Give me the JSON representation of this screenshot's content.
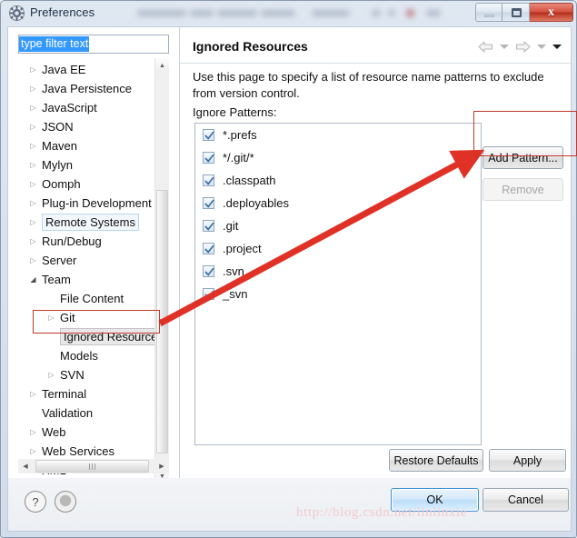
{
  "window": {
    "title": "Preferences",
    "icon": "gear-icon",
    "controls": {
      "minimize": "minimize",
      "maximize": "restore",
      "close": "x"
    }
  },
  "sidebar": {
    "filter": {
      "value": "type filter text",
      "placeholder": "type filter text"
    },
    "items": [
      {
        "label": "Java EE",
        "depth": 0,
        "twisty": "collapsed",
        "state": "normal"
      },
      {
        "label": "Java Persistence",
        "depth": 0,
        "twisty": "collapsed",
        "state": "normal"
      },
      {
        "label": "JavaScript",
        "depth": 0,
        "twisty": "collapsed",
        "state": "normal"
      },
      {
        "label": "JSON",
        "depth": 0,
        "twisty": "collapsed",
        "state": "normal"
      },
      {
        "label": "Maven",
        "depth": 0,
        "twisty": "collapsed",
        "state": "normal"
      },
      {
        "label": "Mylyn",
        "depth": 0,
        "twisty": "collapsed",
        "state": "normal"
      },
      {
        "label": "Oomph",
        "depth": 0,
        "twisty": "collapsed",
        "state": "normal"
      },
      {
        "label": "Plug-in Development",
        "depth": 0,
        "twisty": "collapsed",
        "state": "normal"
      },
      {
        "label": "Remote Systems",
        "depth": 0,
        "twisty": "collapsed",
        "state": "focused"
      },
      {
        "label": "Run/Debug",
        "depth": 0,
        "twisty": "collapsed",
        "state": "normal"
      },
      {
        "label": "Server",
        "depth": 0,
        "twisty": "collapsed",
        "state": "normal"
      },
      {
        "label": "Team",
        "depth": 0,
        "twisty": "expanded",
        "state": "normal"
      },
      {
        "label": "File Content",
        "depth": 1,
        "twisty": "none",
        "state": "normal"
      },
      {
        "label": "Git",
        "depth": 1,
        "twisty": "collapsed",
        "state": "normal"
      },
      {
        "label": "Ignored Resource",
        "depth": 1,
        "twisty": "none",
        "state": "selected"
      },
      {
        "label": "Models",
        "depth": 1,
        "twisty": "none",
        "state": "normal"
      },
      {
        "label": "SVN",
        "depth": 1,
        "twisty": "collapsed",
        "state": "normal"
      },
      {
        "label": "Terminal",
        "depth": 0,
        "twisty": "collapsed",
        "state": "normal"
      },
      {
        "label": "Validation",
        "depth": 0,
        "twisty": "none",
        "state": "normal"
      },
      {
        "label": "Web",
        "depth": 0,
        "twisty": "collapsed",
        "state": "normal"
      },
      {
        "label": "Web Services",
        "depth": 0,
        "twisty": "collapsed",
        "state": "normal"
      },
      {
        "label": "XML",
        "depth": 0,
        "twisty": "collapsed",
        "state": "normal"
      }
    ]
  },
  "page": {
    "title": "Ignored Resources",
    "description": "Use this page to specify a list of resource name patterns to exclude from version control.",
    "sublabel": "Ignore Patterns:",
    "nav": {
      "back_icon": "back-arrow-icon",
      "back_menu_icon": "chevron-down-icon",
      "forward_icon": "forward-arrow-icon",
      "forward_menu_icon": "chevron-down-icon",
      "view_menu_icon": "chevron-down-icon"
    },
    "patterns": [
      {
        "label": "*.prefs",
        "checked": true
      },
      {
        "label": "*/.git/*",
        "checked": true
      },
      {
        "label": ".classpath",
        "checked": true
      },
      {
        "label": ".deployables",
        "checked": true
      },
      {
        "label": ".git",
        "checked": true
      },
      {
        "label": ".project",
        "checked": true
      },
      {
        "label": ".svn",
        "checked": true
      },
      {
        "label": "_svn",
        "checked": true
      }
    ],
    "buttons": {
      "add_pattern": "Add Pattern...",
      "remove": "Remove",
      "remove_enabled": false,
      "restore_defaults": "Restore Defaults",
      "apply": "Apply"
    }
  },
  "footer": {
    "help_icon": "question-mark-icon",
    "menu_icon": "circle-menu-icon",
    "ok": "OK",
    "cancel": "Cancel"
  },
  "watermark": "http://blog.csdn.net/linlinxie",
  "annotation": {
    "color": "#c0392b",
    "arrow": "red-arrow",
    "box_sidebar": "Ignored Resource",
    "box_buttons": "Add Pattern..."
  }
}
